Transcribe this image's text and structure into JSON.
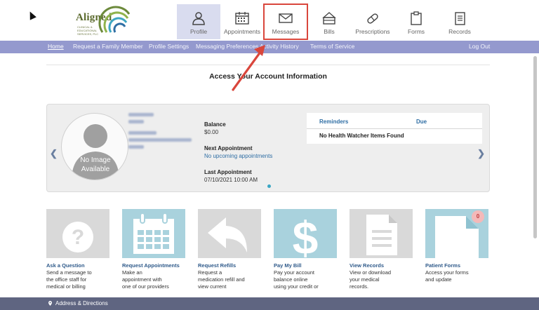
{
  "logo": {
    "name": "Aligned",
    "subtitle": "Clinical & Educational Services, PLC"
  },
  "top_nav": [
    {
      "label": "Profile",
      "icon": "person-icon",
      "active": true
    },
    {
      "label": "Appointments",
      "icon": "calendar-icon"
    },
    {
      "label": "Messages",
      "icon": "envelope-icon",
      "highlighted": true
    },
    {
      "label": "Bills",
      "icon": "wallet-icon"
    },
    {
      "label": "Prescriptions",
      "icon": "pill-icon"
    },
    {
      "label": "Forms",
      "icon": "clipboard-icon"
    },
    {
      "label": "Records",
      "icon": "document-icon"
    }
  ],
  "sub_nav": {
    "home": "Home",
    "request_family": "Request a Family Member",
    "profile_settings": "Profile Settings",
    "messaging_prefs": "Messaging Preferences",
    "activity_history": "Activity History",
    "terms": "Terms of Service",
    "logout": "Log Out"
  },
  "page_title": "Access Your Account Information",
  "profile": {
    "no_image_line1": "No Image",
    "no_image_line2": "Available",
    "balance_label": "Balance",
    "balance_value": "$0.00",
    "next_appt_label": "Next Appointment",
    "next_appt_value": "No upcoming appointments",
    "last_appt_label": "Last Appointment",
    "last_appt_value": "07/10/2021 10:00 AM"
  },
  "reminders": {
    "col_reminders": "Reminders",
    "col_due": "Due",
    "empty": "No Health Watcher Items Found"
  },
  "tiles": [
    {
      "title": "Ask a Question",
      "desc": [
        "Send a message to",
        "the office staff for",
        "medical or billing"
      ]
    },
    {
      "title": "Request Appointments",
      "desc": [
        "Make an",
        "appointment with",
        "one of our providers"
      ]
    },
    {
      "title": "Request Refills",
      "desc": [
        "Request a",
        "medication refill and",
        "view current"
      ]
    },
    {
      "title": "Pay My Bill",
      "desc": [
        "Pay your account",
        "balance online",
        "using your credit or"
      ]
    },
    {
      "title": "View Records",
      "desc": [
        "View or download",
        "your medical",
        "records."
      ]
    },
    {
      "title": "Patient Forms",
      "desc": [
        "Access your forms",
        "and update",
        ""
      ],
      "badge": "0"
    }
  ],
  "footer": {
    "address": "Address & Directions"
  },
  "colors": {
    "purple_bar": "#9499ce",
    "footer": "#5f6581",
    "highlight": "#d9463c",
    "link": "#2f6ea4"
  }
}
